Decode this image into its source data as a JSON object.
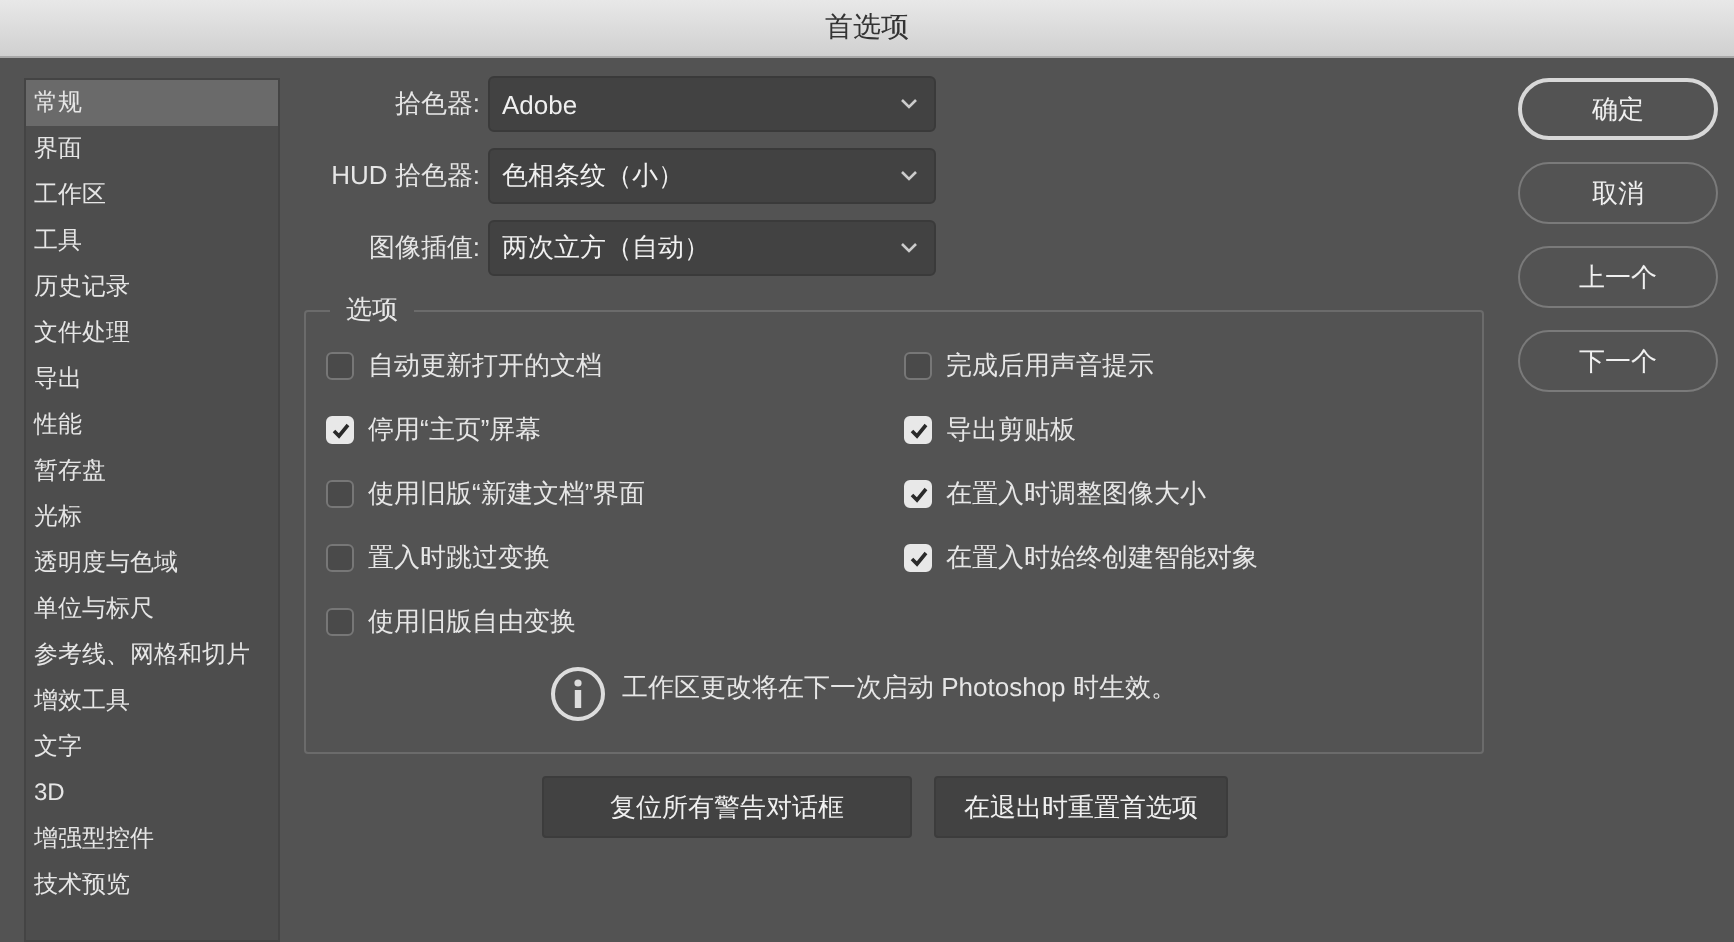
{
  "window": {
    "title": "首选项"
  },
  "sidebar": {
    "items": [
      {
        "label": "常规",
        "selected": true
      },
      {
        "label": "界面",
        "selected": false
      },
      {
        "label": "工作区",
        "selected": false
      },
      {
        "label": "工具",
        "selected": false
      },
      {
        "label": "历史记录",
        "selected": false
      },
      {
        "label": "文件处理",
        "selected": false
      },
      {
        "label": "导出",
        "selected": false
      },
      {
        "label": "性能",
        "selected": false
      },
      {
        "label": "暂存盘",
        "selected": false
      },
      {
        "label": "光标",
        "selected": false
      },
      {
        "label": "透明度与色域",
        "selected": false
      },
      {
        "label": "单位与标尺",
        "selected": false
      },
      {
        "label": "参考线、网格和切片",
        "selected": false
      },
      {
        "label": "增效工具",
        "selected": false
      },
      {
        "label": "文字",
        "selected": false
      },
      {
        "label": "3D",
        "selected": false
      },
      {
        "label": "增强型控件",
        "selected": false
      },
      {
        "label": "技术预览",
        "selected": false
      }
    ]
  },
  "dropdowns": [
    {
      "label": "拾色器:",
      "value": "Adobe"
    },
    {
      "label": "HUD 拾色器:",
      "value": "色相条纹（小）"
    },
    {
      "label": "图像插值:",
      "value": "两次立方（自动）"
    }
  ],
  "options": {
    "title": "选项",
    "left": [
      {
        "label": "自动更新打开的文档",
        "checked": false
      },
      {
        "label": "停用“主页”屏幕",
        "checked": true
      },
      {
        "label": "使用旧版“新建文档”界面",
        "checked": false
      },
      {
        "label": "置入时跳过变换",
        "checked": false
      },
      {
        "label": "使用旧版自由变换",
        "checked": false
      }
    ],
    "right": [
      {
        "label": "完成后用声音提示",
        "checked": false
      },
      {
        "label": "导出剪贴板",
        "checked": true
      },
      {
        "label": "在置入时调整图像大小",
        "checked": true
      },
      {
        "label": "在置入时始终创建智能对象",
        "checked": true
      }
    ],
    "notice": "工作区更改将在下一次启动 Photoshop 时生效。"
  },
  "bottom_buttons": [
    "复位所有警告对话框",
    "在退出时重置首选项"
  ],
  "side_buttons": [
    {
      "label": "确定",
      "default": true
    },
    {
      "label": "取消",
      "default": false
    },
    {
      "label": "上一个",
      "default": false
    },
    {
      "label": "下一个",
      "default": false
    }
  ]
}
